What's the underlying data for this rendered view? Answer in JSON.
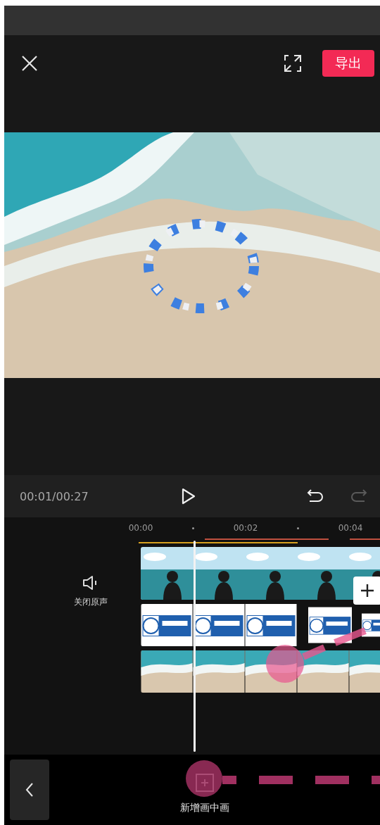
{
  "top_bar": {
    "export_button": "导出"
  },
  "player": {
    "time": "00:01/00:27",
    "undo": {
      "disabled": false
    },
    "redo": {
      "disabled": true
    }
  },
  "ruler": {
    "ticks": [
      "00:00",
      "00:02",
      "00:04"
    ]
  },
  "audio_toggle": {
    "label": "关闭原声"
  },
  "tracks": [
    {
      "kind": "main"
    },
    {
      "kind": "overlay"
    },
    {
      "kind": "beach"
    }
  ],
  "bottom_bar": {
    "tool": "新增画中画"
  }
}
